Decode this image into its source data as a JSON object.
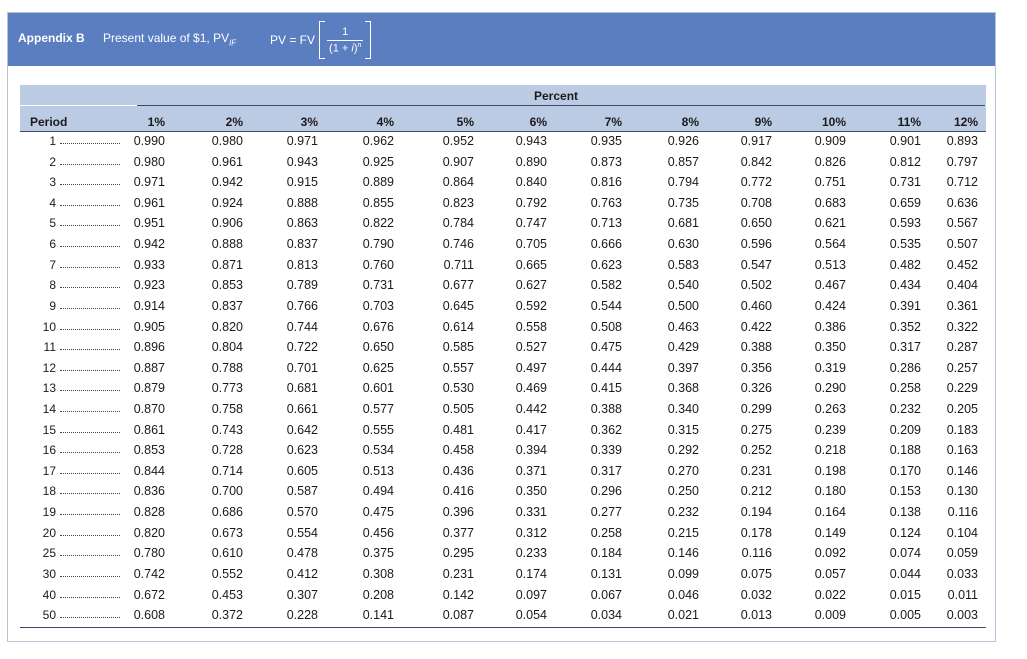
{
  "header": {
    "appendix_label": "Appendix B",
    "subtitle_text": "Present value of $1, PV",
    "subtitle_subscript": "IF",
    "formula_lhs": "PV = FV",
    "formula_numerator": "1",
    "formula_denominator_open": "(1 + ",
    "formula_denominator_var": "i",
    "formula_denominator_close": ")",
    "formula_exponent": "n"
  },
  "table": {
    "group_header": "Percent",
    "period_header": "Period",
    "columns": [
      "1%",
      "2%",
      "3%",
      "4%",
      "5%",
      "6%",
      "7%",
      "8%",
      "9%",
      "10%",
      "11%",
      "12%"
    ],
    "rows": [
      {
        "period": "1",
        "values": [
          "0.990",
          "0.980",
          "0.971",
          "0.962",
          "0.952",
          "0.943",
          "0.935",
          "0.926",
          "0.917",
          "0.909",
          "0.901",
          "0.893"
        ]
      },
      {
        "period": "2",
        "values": [
          "0.980",
          "0.961",
          "0.943",
          "0.925",
          "0.907",
          "0.890",
          "0.873",
          "0.857",
          "0.842",
          "0.826",
          "0.812",
          "0.797"
        ]
      },
      {
        "period": "3",
        "values": [
          "0.971",
          "0.942",
          "0.915",
          "0.889",
          "0.864",
          "0.840",
          "0.816",
          "0.794",
          "0.772",
          "0.751",
          "0.731",
          "0.712"
        ]
      },
      {
        "period": "4",
        "values": [
          "0.961",
          "0.924",
          "0.888",
          "0.855",
          "0.823",
          "0.792",
          "0.763",
          "0.735",
          "0.708",
          "0.683",
          "0.659",
          "0.636"
        ]
      },
      {
        "period": "5",
        "values": [
          "0.951",
          "0.906",
          "0.863",
          "0.822",
          "0.784",
          "0.747",
          "0.713",
          "0.681",
          "0.650",
          "0.621",
          "0.593",
          "0.567"
        ]
      },
      {
        "period": "6",
        "values": [
          "0.942",
          "0.888",
          "0.837",
          "0.790",
          "0.746",
          "0.705",
          "0.666",
          "0.630",
          "0.596",
          "0.564",
          "0.535",
          "0.507"
        ]
      },
      {
        "period": "7",
        "values": [
          "0.933",
          "0.871",
          "0.813",
          "0.760",
          "0.711",
          "0.665",
          "0.623",
          "0.583",
          "0.547",
          "0.513",
          "0.482",
          "0.452"
        ]
      },
      {
        "period": "8",
        "values": [
          "0.923",
          "0.853",
          "0.789",
          "0.731",
          "0.677",
          "0.627",
          "0.582",
          "0.540",
          "0.502",
          "0.467",
          "0.434",
          "0.404"
        ]
      },
      {
        "period": "9",
        "values": [
          "0.914",
          "0.837",
          "0.766",
          "0.703",
          "0.645",
          "0.592",
          "0.544",
          "0.500",
          "0.460",
          "0.424",
          "0.391",
          "0.361"
        ]
      },
      {
        "period": "10",
        "values": [
          "0.905",
          "0.820",
          "0.744",
          "0.676",
          "0.614",
          "0.558",
          "0.508",
          "0.463",
          "0.422",
          "0.386",
          "0.352",
          "0.322"
        ]
      },
      {
        "period": "11",
        "values": [
          "0.896",
          "0.804",
          "0.722",
          "0.650",
          "0.585",
          "0.527",
          "0.475",
          "0.429",
          "0.388",
          "0.350",
          "0.317",
          "0.287"
        ]
      },
      {
        "period": "12",
        "values": [
          "0.887",
          "0.788",
          "0.701",
          "0.625",
          "0.557",
          "0.497",
          "0.444",
          "0.397",
          "0.356",
          "0.319",
          "0.286",
          "0.257"
        ]
      },
      {
        "period": "13",
        "values": [
          "0.879",
          "0.773",
          "0.681",
          "0.601",
          "0.530",
          "0.469",
          "0.415",
          "0.368",
          "0.326",
          "0.290",
          "0.258",
          "0.229"
        ]
      },
      {
        "period": "14",
        "values": [
          "0.870",
          "0.758",
          "0.661",
          "0.577",
          "0.505",
          "0.442",
          "0.388",
          "0.340",
          "0.299",
          "0.263",
          "0.232",
          "0.205"
        ]
      },
      {
        "period": "15",
        "values": [
          "0.861",
          "0.743",
          "0.642",
          "0.555",
          "0.481",
          "0.417",
          "0.362",
          "0.315",
          "0.275",
          "0.239",
          "0.209",
          "0.183"
        ]
      },
      {
        "period": "16",
        "values": [
          "0.853",
          "0.728",
          "0.623",
          "0.534",
          "0.458",
          "0.394",
          "0.339",
          "0.292",
          "0.252",
          "0.218",
          "0.188",
          "0.163"
        ]
      },
      {
        "period": "17",
        "values": [
          "0.844",
          "0.714",
          "0.605",
          "0.513",
          "0.436",
          "0.371",
          "0.317",
          "0.270",
          "0.231",
          "0.198",
          "0.170",
          "0.146"
        ]
      },
      {
        "period": "18",
        "values": [
          "0.836",
          "0.700",
          "0.587",
          "0.494",
          "0.416",
          "0.350",
          "0.296",
          "0.250",
          "0.212",
          "0.180",
          "0.153",
          "0.130"
        ]
      },
      {
        "period": "19",
        "values": [
          "0.828",
          "0.686",
          "0.570",
          "0.475",
          "0.396",
          "0.331",
          "0.277",
          "0.232",
          "0.194",
          "0.164",
          "0.138",
          "0.116"
        ]
      },
      {
        "period": "20",
        "values": [
          "0.820",
          "0.673",
          "0.554",
          "0.456",
          "0.377",
          "0.312",
          "0.258",
          "0.215",
          "0.178",
          "0.149",
          "0.124",
          "0.104"
        ]
      },
      {
        "period": "25",
        "values": [
          "0.780",
          "0.610",
          "0.478",
          "0.375",
          "0.295",
          "0.233",
          "0.184",
          "0.146",
          "0.116",
          "0.092",
          "0.074",
          "0.059"
        ]
      },
      {
        "period": "30",
        "values": [
          "0.742",
          "0.552",
          "0.412",
          "0.308",
          "0.231",
          "0.174",
          "0.131",
          "0.099",
          "0.075",
          "0.057",
          "0.044",
          "0.033"
        ]
      },
      {
        "period": "40",
        "values": [
          "0.672",
          "0.453",
          "0.307",
          "0.208",
          "0.142",
          "0.097",
          "0.067",
          "0.046",
          "0.032",
          "0.022",
          "0.015",
          "0.011"
        ]
      },
      {
        "period": "50",
        "values": [
          "0.608",
          "0.372",
          "0.228",
          "0.141",
          "0.087",
          "0.054",
          "0.034",
          "0.021",
          "0.013",
          "0.009",
          "0.005",
          "0.003"
        ]
      }
    ]
  },
  "colors": {
    "banner": "#5a7ec0",
    "header_band": "#bccbe4"
  }
}
